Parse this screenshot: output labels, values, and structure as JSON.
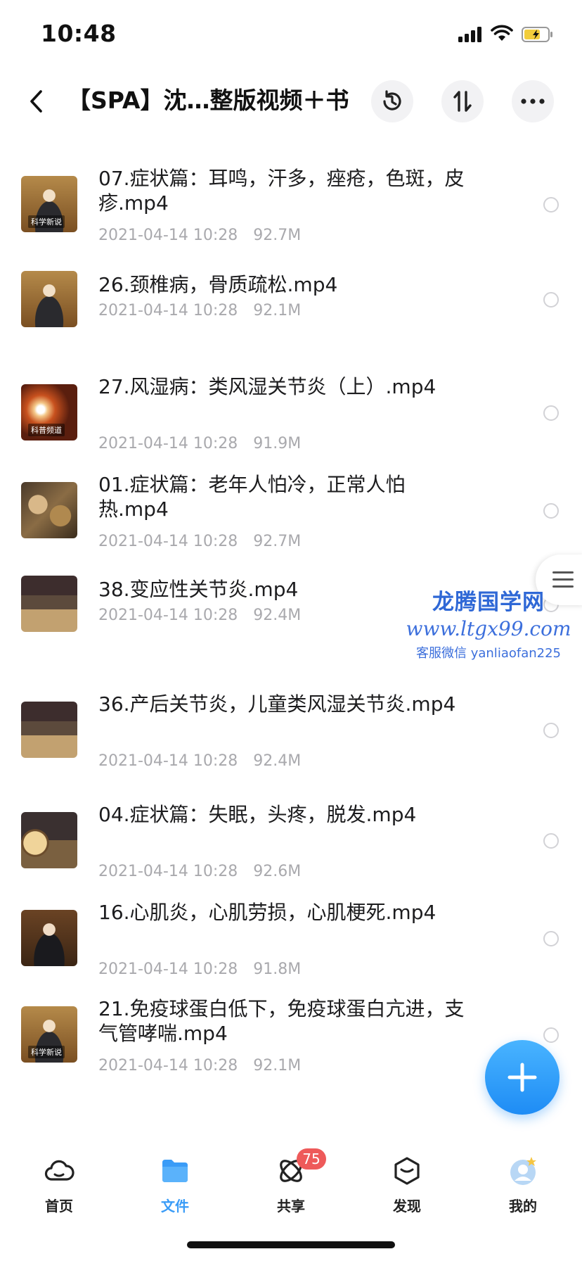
{
  "status_bar": {
    "time": "10:48"
  },
  "header": {
    "title": "【SPA】沈…整版视频＋书"
  },
  "files": [
    {
      "name": "07.症状篇：耳鸣，汗多，痤疮，色斑，皮疹.mp4",
      "date": "2021-04-14 10:28",
      "size": "92.7M",
      "thumb_label": "科学新说",
      "thumb_style": "presenter-warm"
    },
    {
      "name": "26.颈椎病，骨质疏松.mp4",
      "date": "2021-04-14 10:28",
      "size": "92.1M",
      "thumb_label": "",
      "thumb_style": "presenter-warm"
    },
    {
      "name": "27.风湿病：类风湿关节炎（上）.mp4",
      "date": "2021-04-14 10:28",
      "size": "91.9M",
      "thumb_label": "科普频道",
      "thumb_style": "swirl"
    },
    {
      "name": "01.症状篇：老年人怕冷，正常人怕热.mp4",
      "date": "2021-04-14 10:28",
      "size": "92.7M",
      "thumb_label": "",
      "thumb_style": "herbs"
    },
    {
      "name": "38.变应性关节炎.mp4",
      "date": "2021-04-14 10:28",
      "size": "92.4M",
      "thumb_label": "",
      "thumb_style": "slide"
    },
    {
      "name": "36.产后关节炎，儿童类风湿关节炎.mp4",
      "date": "2021-04-14 10:28",
      "size": "92.4M",
      "thumb_label": "",
      "thumb_style": "slide"
    },
    {
      "name": "04.症状篇：失眠，头疼，脱发.mp4",
      "date": "2021-04-14 10:28",
      "size": "92.6M",
      "thumb_label": "",
      "thumb_style": "slide-circle"
    },
    {
      "name": "16.心肌炎，心肌劳损，心肌梗死.mp4",
      "date": "2021-04-14 10:28",
      "size": "91.8M",
      "thumb_label": "",
      "thumb_style": "presenter-dark"
    },
    {
      "name": "21.免疫球蛋白低下，免疫球蛋白亢进，支气管哮喘.mp4",
      "date": "2021-04-14 10:28",
      "size": "92.1M",
      "thumb_label": "科学新说",
      "thumb_style": "presenter-warm"
    }
  ],
  "watermark": {
    "title": "龙腾国学网",
    "url": "www.ltgx99.com",
    "contact": "客服微信 yanliaofan225"
  },
  "tabs": [
    {
      "label": "首页",
      "icon": "cloud-icon",
      "active": false
    },
    {
      "label": "文件",
      "icon": "folder-icon",
      "active": true
    },
    {
      "label": "共享",
      "icon": "share-icon",
      "active": false,
      "badge": "75"
    },
    {
      "label": "发现",
      "icon": "discover-icon",
      "active": false
    },
    {
      "label": "我的",
      "icon": "avatar-icon",
      "active": false
    }
  ],
  "colors": {
    "accent": "#3a9cf7",
    "badge": "#ee5a5a",
    "meta_text": "#a9a9ad"
  }
}
